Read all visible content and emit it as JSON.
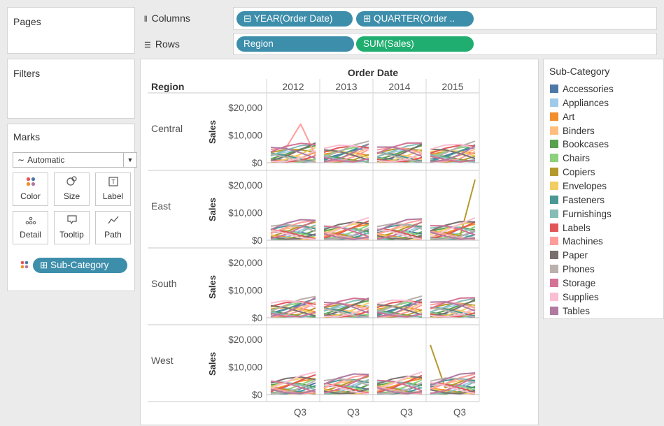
{
  "pages_panel": {
    "title": "Pages"
  },
  "filters_panel": {
    "title": "Filters"
  },
  "columns_shelf": {
    "label": "Columns",
    "pills": [
      "⊟ YEAR(Order Date)",
      "⊞ QUARTER(Order .."
    ]
  },
  "rows_shelf": {
    "label": "Rows",
    "pills": [
      "Region",
      "SUM(Sales)"
    ]
  },
  "marks_card": {
    "title": "Marks",
    "mark_type": "Automatic",
    "buttons": [
      {
        "label": "Color",
        "icon": "color-dots-icon"
      },
      {
        "label": "Size",
        "icon": "size-icon"
      },
      {
        "label": "Label",
        "icon": "label-icon"
      },
      {
        "label": "Detail",
        "icon": "detail-dots-icon"
      },
      {
        "label": "Tooltip",
        "icon": "tooltip-icon"
      },
      {
        "label": "Path",
        "icon": "path-icon"
      }
    ],
    "color_field": "⊞ Sub-Category"
  },
  "legend": {
    "title": "Sub-Category",
    "items": [
      {
        "label": "Accessories",
        "color": "#4e79a7"
      },
      {
        "label": "Appliances",
        "color": "#a0cbe8"
      },
      {
        "label": "Art",
        "color": "#f28e2b"
      },
      {
        "label": "Binders",
        "color": "#ffbe7d"
      },
      {
        "label": "Bookcases",
        "color": "#59a14f"
      },
      {
        "label": "Chairs",
        "color": "#8cd17d"
      },
      {
        "label": "Copiers",
        "color": "#b6992d"
      },
      {
        "label": "Envelopes",
        "color": "#f1ce63"
      },
      {
        "label": "Fasteners",
        "color": "#499894"
      },
      {
        "label": "Furnishings",
        "color": "#86bcb6"
      },
      {
        "label": "Labels",
        "color": "#e15759"
      },
      {
        "label": "Machines",
        "color": "#ff9d9a"
      },
      {
        "label": "Paper",
        "color": "#79706e"
      },
      {
        "label": "Phones",
        "color": "#bab0ac"
      },
      {
        "label": "Storage",
        "color": "#d37295"
      },
      {
        "label": "Supplies",
        "color": "#fabfd2"
      },
      {
        "label": "Tables",
        "color": "#b07aa1"
      }
    ]
  },
  "chart_data": {
    "type": "line",
    "column_header": "Order Date",
    "row_header": "Region",
    "years": [
      "2012",
      "2013",
      "2014",
      "2015"
    ],
    "x_tick_label": "Q3",
    "regions": [
      "Central",
      "East",
      "South",
      "West"
    ],
    "ylabel": "Sales",
    "yticks": [
      "$20,000",
      "$10,000",
      "$0"
    ],
    "ylim": [
      0,
      22000
    ],
    "grid": false
  }
}
